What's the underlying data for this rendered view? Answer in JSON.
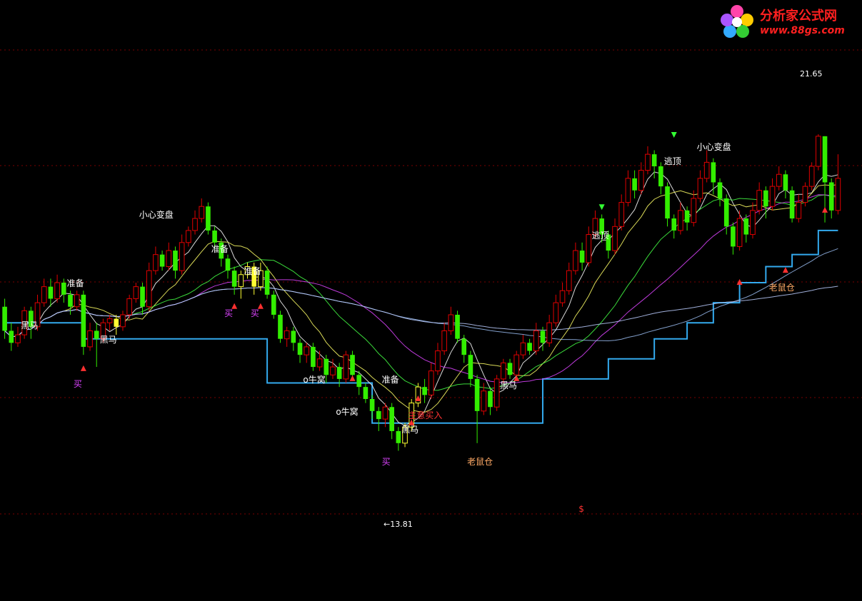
{
  "logo": {
    "title": "分析家公式网",
    "url": "www.88gs.com"
  },
  "colors": {
    "background": "#000000",
    "grid": "#7a0000",
    "up_candle": "#e00000",
    "down_candle": "#33ee00",
    "yellow_candle": "#ffff33",
    "support_line": "#33aaee",
    "ma_white": "#ffffff",
    "ma_yellow": "#ffff66",
    "ma_green": "#44ff44",
    "ma_magenta": "#dd44ff",
    "ma_slow": "#99bbee",
    "ma_slow2": "#bbccff"
  },
  "chart_data": {
    "type": "candlestick",
    "title": "",
    "ylim": [
      12.2,
      23.8
    ],
    "price_high_label": "21.65",
    "price_low_label": "←13.81",
    "price_high": 21.65,
    "price_low": 13.81,
    "bar_count": 128,
    "annotations": [
      {
        "text": "黑马",
        "bar": 4,
        "price": 16.95,
        "color": "#ffffff"
      },
      {
        "text": "准备",
        "bar": 11,
        "price": 18.0,
        "color": "#ffffff"
      },
      {
        "text": "黑马",
        "bar": 16,
        "price": 16.6,
        "color": "#ffffff"
      },
      {
        "text": "买",
        "bar": 12,
        "price": 15.5,
        "color": "#dd44ff"
      },
      {
        "text": "小心变盘",
        "bar": 22,
        "price": 19.7,
        "color": "#ffffff"
      },
      {
        "text": "准备",
        "bar": 33,
        "price": 18.85,
        "color": "#ffffff"
      },
      {
        "text": "买",
        "bar": 35,
        "price": 17.25,
        "color": "#dd44ff"
      },
      {
        "text": "买",
        "bar": 39,
        "price": 17.25,
        "color": "#dd44ff"
      },
      {
        "text": "准备",
        "bar": 38,
        "price": 18.3,
        "color": "#ffffff"
      },
      {
        "text": "o牛窝",
        "bar": 47,
        "price": 15.6,
        "color": "#ffffff"
      },
      {
        "text": "o牛窝",
        "bar": 52,
        "price": 14.8,
        "color": "#ffffff"
      },
      {
        "text": "准备",
        "bar": 59,
        "price": 15.6,
        "color": "#ffffff"
      },
      {
        "text": "主意买入",
        "bar": 63,
        "price": 14.7,
        "color": "#ff3333"
      },
      {
        "text": "黑马",
        "bar": 62,
        "price": 14.35,
        "color": "#ffffff"
      },
      {
        "text": "买",
        "bar": 59,
        "price": 13.55,
        "color": "#dd44ff"
      },
      {
        "text": "老鼠仓",
        "bar": 72,
        "price": 13.55,
        "color": "#ffaa66"
      },
      {
        "text": "黑马",
        "bar": 77,
        "price": 15.45,
        "color": "#ffffff"
      },
      {
        "text": "逃顶",
        "bar": 91,
        "price": 19.2,
        "color": "#ffffff"
      },
      {
        "text": "逃顶",
        "bar": 102,
        "price": 21.05,
        "color": "#ffffff"
      },
      {
        "text": "小心变盘",
        "bar": 107,
        "price": 21.4,
        "color": "#ffffff"
      },
      {
        "text": "老鼠仓",
        "bar": 118,
        "price": 17.9,
        "color": "#ffaa66"
      },
      {
        "text": "$",
        "bar": 89,
        "price": 12.35,
        "color": "#ff3333"
      }
    ],
    "candles": [
      [
        17.4,
        16.8,
        17.6,
        16.6
      ],
      [
        16.8,
        16.5,
        17.0,
        16.3
      ],
      [
        16.5,
        16.7,
        16.9,
        16.4
      ],
      [
        16.7,
        17.3,
        17.4,
        16.6
      ],
      [
        17.3,
        16.9,
        17.4,
        16.6
      ],
      [
        16.9,
        17.5,
        17.7,
        16.8
      ],
      [
        17.5,
        17.9,
        18.1,
        17.4
      ],
      [
        17.9,
        17.6,
        18.1,
        17.4
      ],
      [
        17.6,
        18.0,
        18.2,
        17.5
      ],
      [
        18.0,
        17.7,
        18.1,
        17.5
      ],
      [
        17.7,
        17.4,
        17.8,
        17.2
      ],
      [
        17.4,
        17.7,
        17.8,
        17.3
      ],
      [
        17.7,
        16.4,
        17.8,
        16.2
      ],
      [
        16.4,
        16.8,
        17.0,
        16.3
      ],
      [
        16.8,
        16.6,
        17.0,
        15.9
      ],
      [
        16.6,
        17.0,
        17.1,
        16.5
      ],
      [
        17.0,
        17.1,
        17.2,
        16.8
      ],
      [
        17.1,
        16.9,
        17.2,
        16.7
      ],
      [
        16.9,
        17.2,
        17.3,
        16.8
      ],
      [
        17.2,
        17.6,
        17.7,
        17.1
      ],
      [
        17.6,
        17.9,
        18.0,
        17.5
      ],
      [
        17.9,
        17.4,
        18.0,
        17.2
      ],
      [
        17.4,
        18.3,
        18.5,
        17.3
      ],
      [
        18.3,
        18.7,
        18.9,
        18.2
      ],
      [
        18.7,
        18.4,
        18.8,
        18.3
      ],
      [
        18.4,
        18.8,
        19.0,
        18.3
      ],
      [
        18.8,
        18.3,
        18.9,
        18.1
      ],
      [
        18.3,
        19.0,
        19.2,
        18.2
      ],
      [
        19.0,
        19.3,
        19.4,
        18.9
      ],
      [
        19.3,
        19.6,
        19.8,
        19.2
      ],
      [
        19.6,
        19.9,
        20.1,
        19.5
      ],
      [
        19.9,
        19.3,
        20.0,
        19.2
      ],
      [
        19.3,
        19.0,
        19.4,
        18.8
      ],
      [
        19.0,
        18.6,
        19.1,
        18.4
      ],
      [
        18.6,
        18.3,
        18.7,
        18.1
      ],
      [
        18.3,
        17.9,
        18.4,
        17.7
      ],
      [
        17.9,
        18.2,
        18.3,
        17.6
      ],
      [
        18.2,
        18.4,
        18.5,
        18.1
      ],
      [
        18.4,
        17.9,
        18.5,
        17.7
      ],
      [
        17.9,
        18.3,
        18.5,
        17.8
      ],
      [
        18.3,
        17.7,
        18.4,
        17.6
      ],
      [
        17.7,
        17.2,
        17.8,
        17.1
      ],
      [
        17.2,
        16.6,
        17.3,
        16.5
      ],
      [
        16.6,
        16.8,
        16.9,
        16.4
      ],
      [
        16.8,
        16.5,
        16.9,
        16.3
      ],
      [
        16.5,
        16.2,
        16.6,
        16.0
      ],
      [
        16.2,
        16.4,
        16.5,
        16.0
      ],
      [
        16.4,
        15.9,
        16.5,
        15.8
      ],
      [
        15.9,
        16.1,
        16.3,
        15.8
      ],
      [
        16.1,
        15.7,
        16.2,
        15.5
      ],
      [
        15.7,
        15.9,
        16.1,
        15.6
      ],
      [
        15.9,
        15.6,
        16.0,
        15.4
      ],
      [
        15.6,
        16.2,
        16.3,
        15.5
      ],
      [
        16.2,
        15.7,
        16.3,
        15.6
      ],
      [
        15.7,
        15.4,
        15.8,
        15.2
      ],
      [
        15.4,
        15.1,
        15.5,
        15.0
      ],
      [
        15.1,
        14.8,
        15.2,
        14.6
      ],
      [
        14.8,
        14.6,
        14.9,
        14.3
      ],
      [
        14.6,
        14.9,
        15.0,
        14.4
      ],
      [
        14.9,
        14.3,
        15.0,
        14.1
      ],
      [
        14.3,
        14.0,
        14.4,
        13.81
      ],
      [
        14.0,
        14.4,
        14.5,
        13.9
      ],
      [
        14.4,
        15.0,
        15.1,
        14.3
      ],
      [
        15.0,
        15.4,
        15.5,
        14.9
      ],
      [
        15.4,
        15.2,
        15.6,
        15.0
      ],
      [
        15.2,
        15.8,
        16.0,
        15.1
      ],
      [
        15.8,
        16.3,
        16.5,
        15.7
      ],
      [
        16.3,
        16.8,
        17.0,
        16.2
      ],
      [
        16.8,
        17.2,
        17.4,
        16.7
      ],
      [
        17.2,
        16.6,
        17.3,
        16.5
      ],
      [
        16.6,
        16.2,
        16.7,
        16.0
      ],
      [
        16.2,
        15.6,
        16.3,
        15.4
      ],
      [
        15.6,
        14.8,
        15.7,
        14.0
      ],
      [
        14.8,
        15.3,
        15.5,
        14.7
      ],
      [
        15.3,
        14.9,
        15.4,
        14.7
      ],
      [
        14.9,
        15.6,
        15.7,
        14.8
      ],
      [
        15.6,
        16.0,
        16.1,
        15.5
      ],
      [
        16.0,
        15.7,
        16.1,
        15.6
      ],
      [
        15.7,
        16.2,
        16.3,
        15.6
      ],
      [
        16.2,
        16.5,
        16.7,
        16.1
      ],
      [
        16.5,
        16.3,
        16.6,
        16.2
      ],
      [
        16.3,
        16.8,
        17.0,
        16.2
      ],
      [
        16.8,
        16.5,
        16.9,
        16.3
      ],
      [
        16.5,
        17.0,
        17.2,
        16.4
      ],
      [
        17.0,
        17.5,
        17.7,
        16.9
      ],
      [
        17.5,
        17.8,
        18.0,
        17.4
      ],
      [
        17.8,
        18.3,
        18.5,
        17.7
      ],
      [
        18.3,
        18.8,
        19.0,
        18.2
      ],
      [
        18.8,
        18.5,
        19.0,
        18.3
      ],
      [
        18.5,
        19.2,
        19.4,
        18.4
      ],
      [
        19.2,
        19.6,
        19.8,
        19.1
      ],
      [
        19.6,
        19.2,
        19.7,
        19.0
      ],
      [
        19.2,
        18.8,
        19.3,
        18.6
      ],
      [
        18.8,
        19.4,
        19.6,
        18.7
      ],
      [
        19.4,
        20.0,
        20.2,
        19.3
      ],
      [
        20.0,
        20.6,
        20.8,
        19.9
      ],
      [
        20.6,
        20.3,
        20.8,
        20.1
      ],
      [
        20.3,
        20.8,
        21.0,
        20.2
      ],
      [
        20.8,
        21.2,
        21.4,
        20.7
      ],
      [
        21.2,
        20.9,
        21.3,
        20.6
      ],
      [
        20.9,
        20.4,
        21.0,
        20.2
      ],
      [
        20.4,
        19.6,
        20.5,
        19.4
      ],
      [
        19.6,
        19.3,
        19.7,
        19.1
      ],
      [
        19.3,
        19.8,
        20.0,
        19.2
      ],
      [
        19.8,
        19.5,
        19.9,
        19.3
      ],
      [
        19.5,
        20.1,
        20.3,
        19.4
      ],
      [
        20.1,
        20.6,
        20.8,
        20.0
      ],
      [
        20.6,
        21.0,
        21.3,
        20.5
      ],
      [
        21.0,
        20.5,
        21.1,
        20.2
      ],
      [
        20.5,
        20.1,
        20.6,
        19.9
      ],
      [
        20.1,
        19.4,
        20.2,
        19.2
      ],
      [
        19.4,
        18.9,
        19.5,
        18.7
      ],
      [
        18.9,
        19.6,
        19.8,
        18.8
      ],
      [
        19.6,
        19.2,
        19.7,
        19.0
      ],
      [
        19.2,
        19.8,
        20.0,
        19.1
      ],
      [
        19.8,
        20.3,
        20.5,
        19.7
      ],
      [
        20.3,
        19.9,
        20.4,
        19.6
      ],
      [
        19.9,
        20.4,
        20.6,
        19.8
      ],
      [
        20.4,
        20.7,
        20.9,
        20.3
      ],
      [
        20.7,
        20.3,
        20.8,
        20.1
      ],
      [
        20.3,
        19.6,
        20.4,
        19.5
      ],
      [
        19.6,
        20.0,
        20.2,
        19.5
      ],
      [
        20.0,
        20.4,
        20.5,
        19.9
      ],
      [
        20.4,
        20.9,
        21.0,
        20.3
      ],
      [
        20.9,
        21.65,
        21.7,
        20.8
      ],
      [
        21.65,
        20.5,
        21.65,
        19.5
      ],
      [
        20.5,
        19.8,
        20.6,
        19.6
      ],
      [
        19.8,
        20.6,
        21.2,
        19.7
      ]
    ],
    "ma_periods": [
      5,
      10,
      20,
      30,
      60,
      120
    ],
    "support_steps": [
      {
        "from_bar": 0,
        "to_bar": 12,
        "price": 17.0
      },
      {
        "from_bar": 12,
        "to_bar": 40,
        "price": 16.6
      },
      {
        "from_bar": 40,
        "to_bar": 56,
        "price": 15.5
      },
      {
        "from_bar": 56,
        "to_bar": 82,
        "price": 14.5
      },
      {
        "from_bar": 82,
        "to_bar": 92,
        "price": 15.6
      },
      {
        "from_bar": 92,
        "to_bar": 99,
        "price": 16.1
      },
      {
        "from_bar": 99,
        "to_bar": 104,
        "price": 16.6
      },
      {
        "from_bar": 104,
        "to_bar": 108,
        "price": 17.0
      },
      {
        "from_bar": 108,
        "to_bar": 112,
        "price": 17.5
      },
      {
        "from_bar": 112,
        "to_bar": 116,
        "price": 18.0
      },
      {
        "from_bar": 116,
        "to_bar": 120,
        "price": 18.4
      },
      {
        "from_bar": 120,
        "to_bar": 124,
        "price": 18.7
      },
      {
        "from_bar": 124,
        "to_bar": 128,
        "price": 19.3
      }
    ]
  }
}
